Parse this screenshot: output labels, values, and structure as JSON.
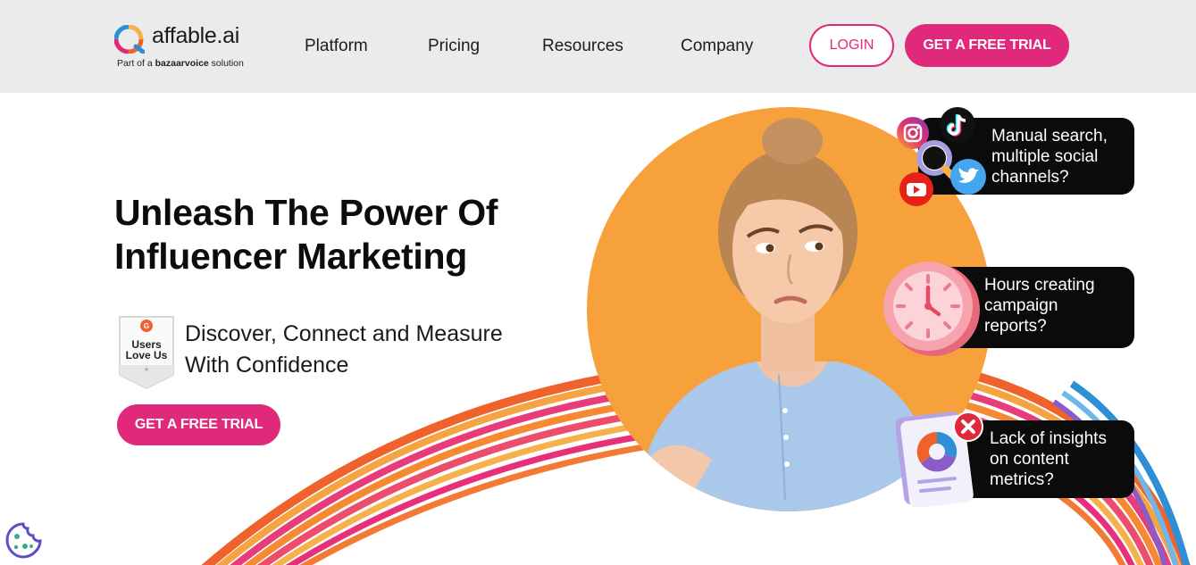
{
  "header": {
    "logo_text": "affable.ai",
    "logo_sub_prefix": "Part of a",
    "logo_sub_brand": "bazaarvoice",
    "logo_sub_suffix": "solution",
    "nav": [
      "Platform",
      "Pricing",
      "Resources",
      "Company"
    ],
    "login_label": "LOGIN",
    "trial_label": "GET A FREE TRIAL"
  },
  "hero": {
    "title_line1": "Unleash The Power Of",
    "title_line2": "Influencer Marketing",
    "badge_line1": "Users",
    "badge_line2": "Love Us",
    "tagline_line1": "Discover, Connect and Measure",
    "tagline_line2": "With Confidence",
    "cta_label": "GET A FREE TRIAL"
  },
  "pain_points": [
    {
      "line1": "Manual search,",
      "line2": "multiple social",
      "line3": "channels?"
    },
    {
      "line1": "Hours creating",
      "line2": "campaign",
      "line3": "reports?"
    },
    {
      "line1": "Lack of insights",
      "line2": "on content",
      "line3": "metrics?"
    }
  ],
  "colors": {
    "brand_pink": "#e0297a",
    "orange": "#f7a13d",
    "header_bg": "#ebebeb"
  },
  "icons": [
    "instagram-icon",
    "tiktok-icon",
    "youtube-icon",
    "twitter-icon",
    "magnifier-icon",
    "clock-icon",
    "report-chart-icon",
    "error-x-icon",
    "cookie-icon",
    "g2-badge-icon"
  ]
}
